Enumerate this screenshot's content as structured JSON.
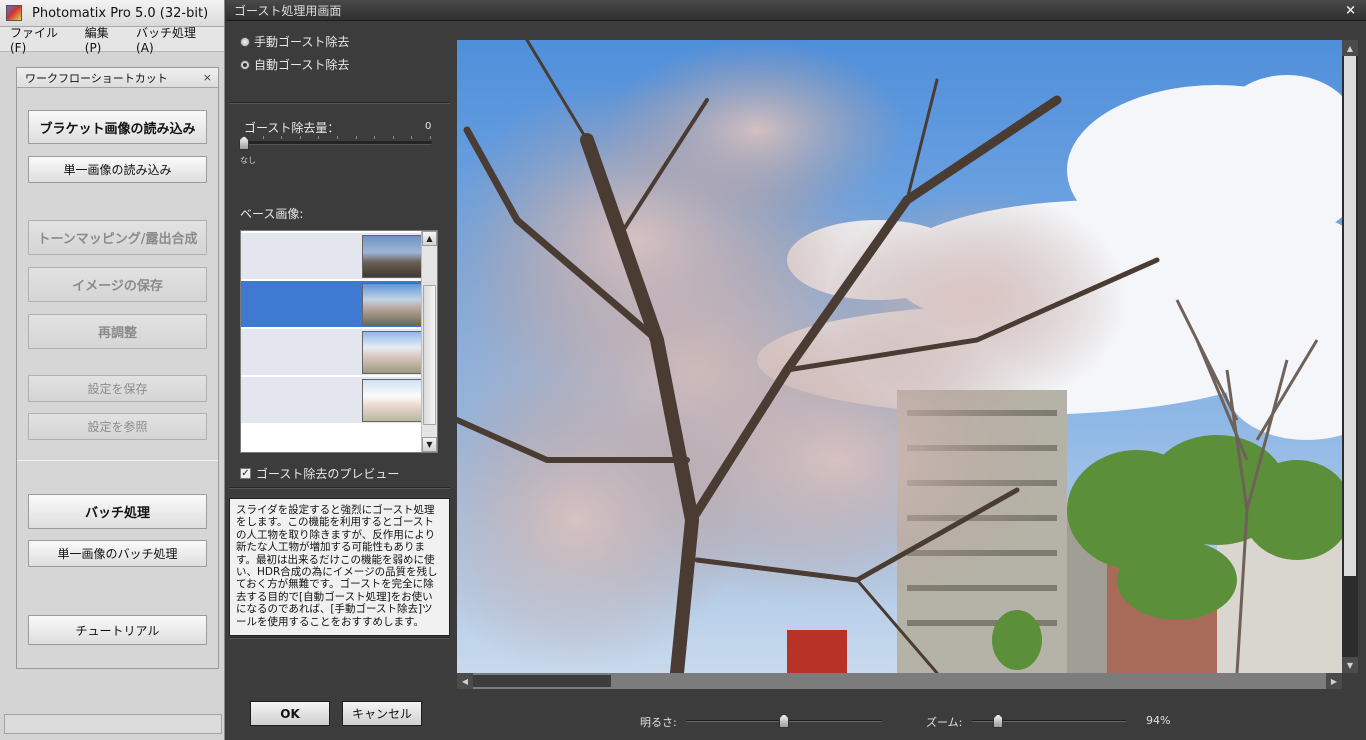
{
  "main_window": {
    "title": "Photomatix Pro 5.0 (32-bit)",
    "menu": [
      "ファイル(F)",
      "編集(P)",
      "バッチ処理(A)"
    ]
  },
  "workflow": {
    "title": "ワークフローショートカット",
    "close_glyph": "×",
    "buttons": {
      "load_bracket": "ブラケット画像の読み込み",
      "load_single": "単一画像の読み込み",
      "tonemap": "トーンマッピング/露出合成",
      "save_image": "イメージの保存",
      "readjust": "再調整",
      "save_settings": "設定を保存",
      "load_settings": "設定を参照",
      "batch": "バッチ処理",
      "batch_single": "単一画像のバッチ処理",
      "tutorial": "チュートリアル"
    }
  },
  "ghost_dialog": {
    "title": "ゴースト処理用画面",
    "close_glyph": "×",
    "manual_label": "手動ゴースト除去",
    "auto_label": "自動ゴースト除去",
    "selected_mode": "auto",
    "amount_label": "ゴースト除去量：",
    "amount_value": "0",
    "amount_min_label": "なし",
    "base_label": "ベース画像:",
    "base_selected_index": 1,
    "base_item_count": 4,
    "preview_label": "ゴースト除去のプレビュー",
    "preview_checked": true,
    "help_text": "スライダを設定すると強烈にゴースト処理をします。この機能を利用するとゴーストの人工物を取り除きますが、反作用により新たな人工物が増加する可能性もあります。最初は出来るだけこの機能を弱めに使い、HDR合成の為にイメージの品質を残しておく方が無難です。ゴーストを完全に除去する目的で[自動ゴースト処理]をお使いになるのであれば、[手動ゴースト除去]ツールを使用することをおすすめします。",
    "ok_label": "OK",
    "cancel_label": "キャンセル",
    "brightness_label": "明るさ:",
    "brightness_level": 0.5,
    "zoom_label": "ズーム:",
    "zoom_value": "94%",
    "zoom_level": 0.17
  },
  "colors": {
    "selection": "#3f7ad2",
    "dialog_bg": "#3c3c3c",
    "panel_bg": "#d4d4d4"
  }
}
